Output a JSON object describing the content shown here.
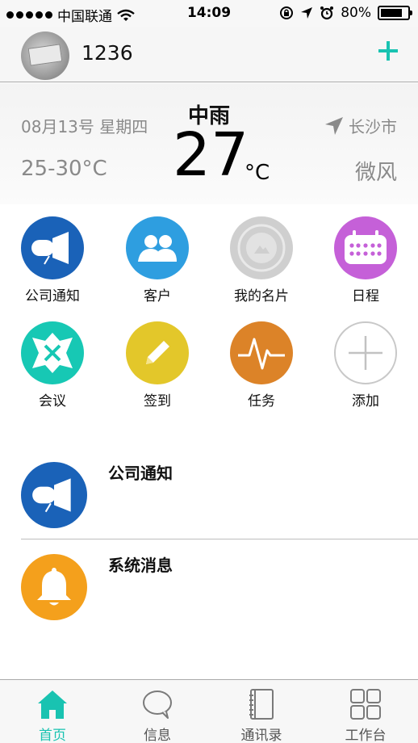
{
  "status": {
    "carrier": "中国联通",
    "time": "14:09",
    "battery_percent": "80%",
    "battery_level": 0.8
  },
  "header": {
    "username": "1236"
  },
  "weather": {
    "date": "08月13号 星期四",
    "condition": "中雨",
    "temperature": "27",
    "unit": "°C",
    "range": "25-30°C",
    "city": "长沙市",
    "wind": "微风"
  },
  "grid": [
    {
      "label": "公司通知",
      "icon": "megaphone-icon",
      "color": "#1a62b8"
    },
    {
      "label": "客户",
      "icon": "users-icon",
      "color": "#2e9ee0"
    },
    {
      "label": "我的名片",
      "icon": "card-icon",
      "color": "#cfcfcf"
    },
    {
      "label": "日程",
      "icon": "calendar-icon",
      "color": "#c560d8"
    },
    {
      "label": "会议",
      "icon": "meeting-icon",
      "color": "#17c8b4"
    },
    {
      "label": "签到",
      "icon": "pencil-icon",
      "color": "#e3c72a"
    },
    {
      "label": "任务",
      "icon": "pulse-icon",
      "color": "#dc8328"
    },
    {
      "label": "添加",
      "icon": "plus-icon",
      "color": "#ffffff"
    }
  ],
  "messages": [
    {
      "title": "公司通知",
      "icon": "megaphone-icon",
      "color": "#1a62b8"
    },
    {
      "title": "系统消息",
      "icon": "bell-icon",
      "color": "#f4a01c"
    }
  ],
  "tabs": [
    {
      "label": "首页",
      "icon": "home-icon",
      "active": true
    },
    {
      "label": "信息",
      "icon": "chat-icon",
      "active": false
    },
    {
      "label": "通讯录",
      "icon": "contacts-icon",
      "active": false
    },
    {
      "label": "工作台",
      "icon": "workbench-icon",
      "active": false
    }
  ],
  "accent": "#19c3b1"
}
